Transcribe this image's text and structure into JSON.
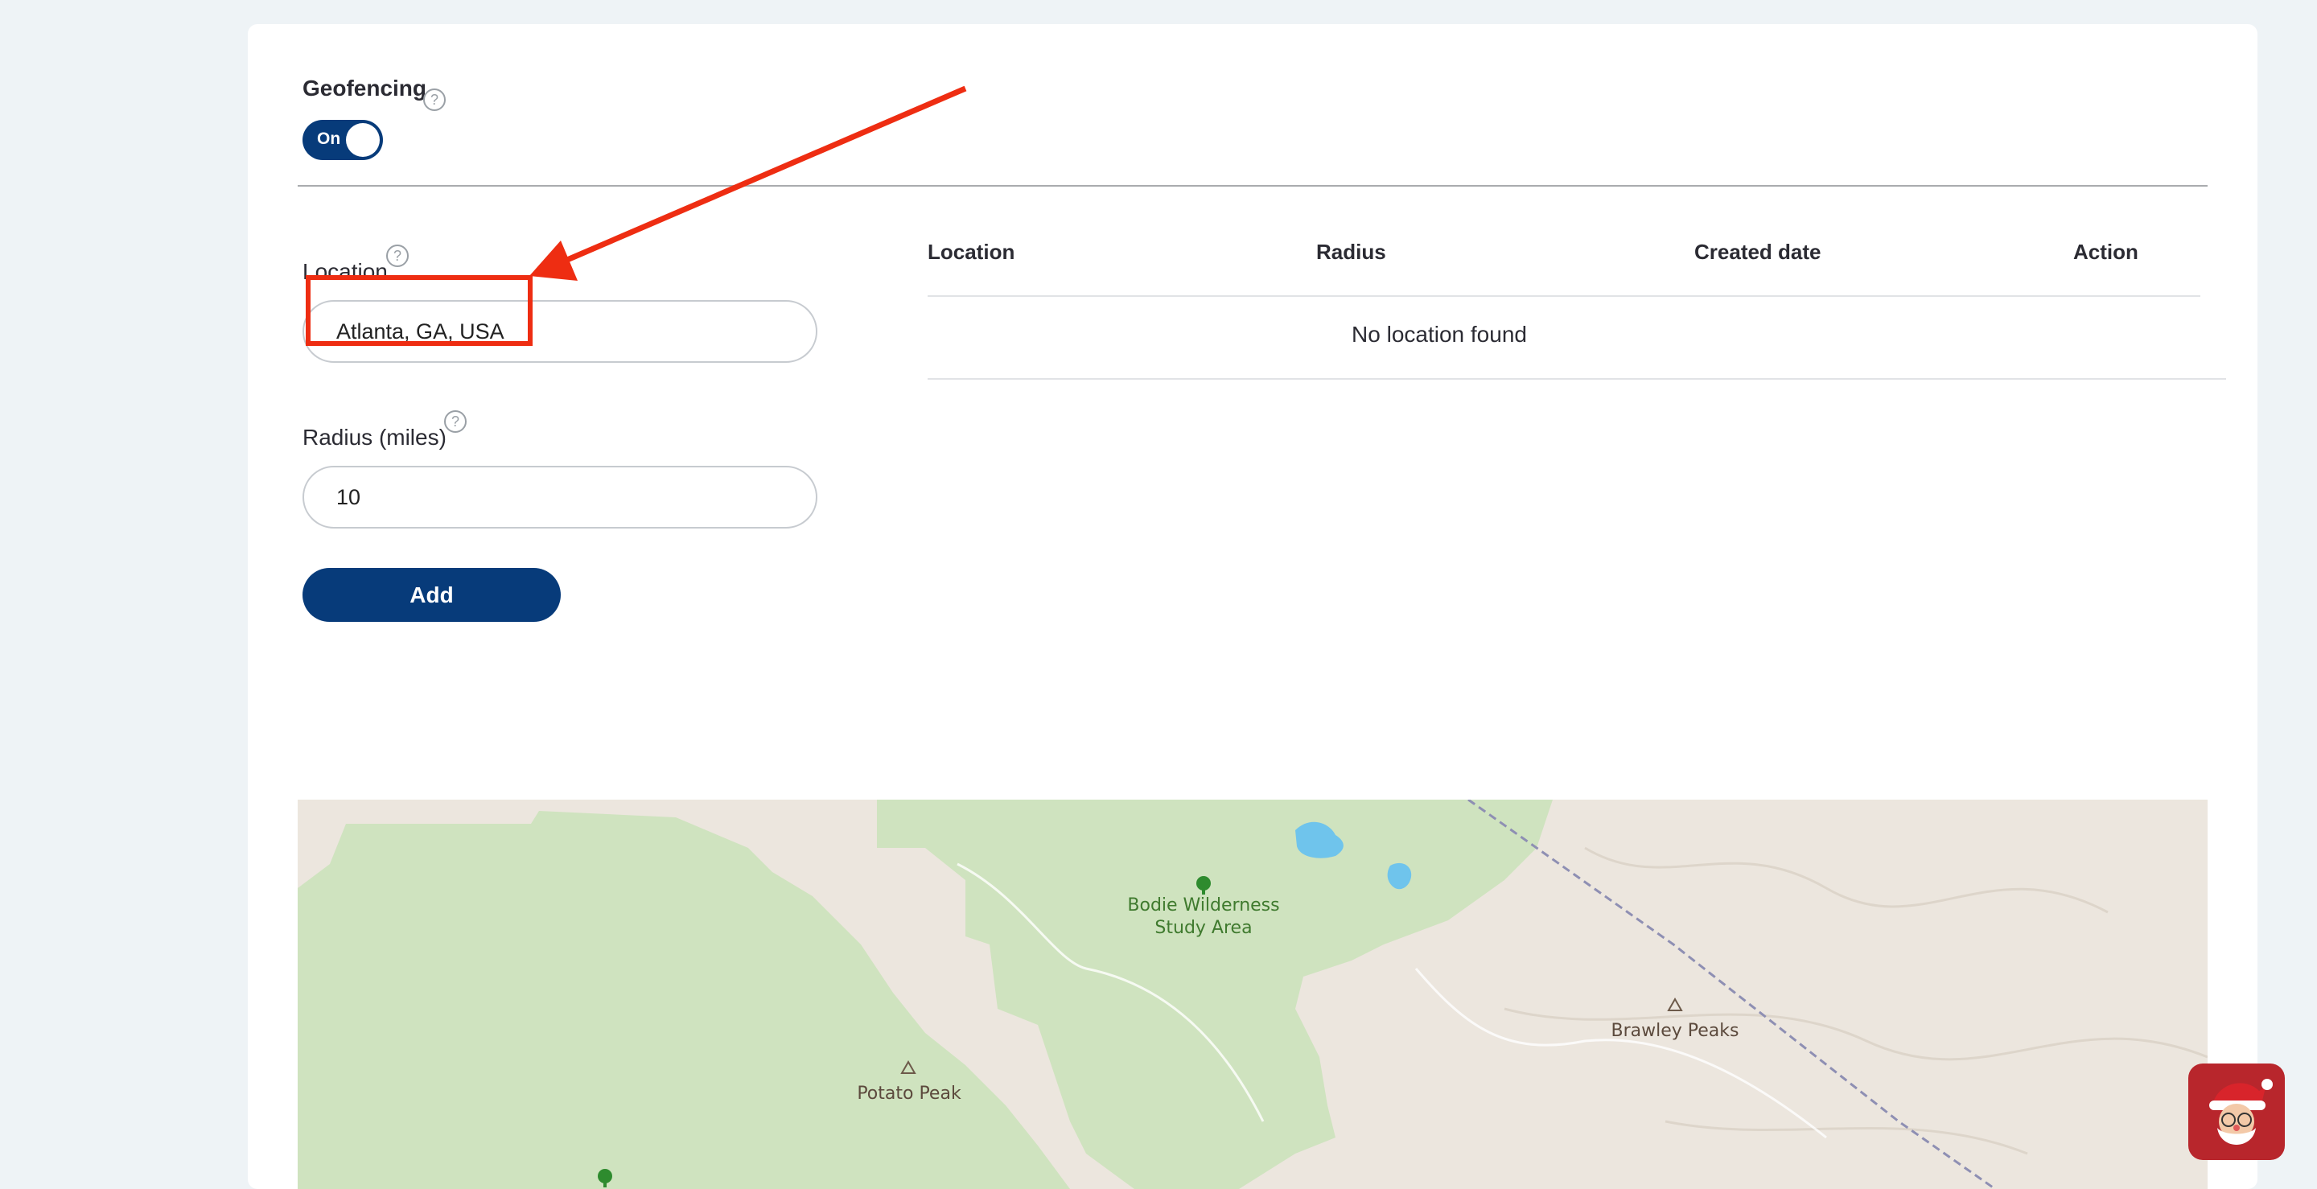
{
  "geofencing": {
    "title": "Geofencing",
    "help": "?",
    "toggle_label": "On"
  },
  "form": {
    "location_label": "Location",
    "location_help": "?",
    "location_value": "Atlanta, GA, USA",
    "radius_label": "Radius (miles)",
    "radius_help": "?",
    "radius_value": "10",
    "add_label": "Add"
  },
  "table": {
    "columns": [
      "Location",
      "Radius",
      "Created date",
      "Action"
    ],
    "empty_message": "No location found"
  },
  "map": {
    "labels": {
      "bodie_line1": "Bodie Wilderness",
      "bodie_line2": "Study Area",
      "potato": "Potato Peak",
      "brawley": "Brawley Peaks"
    }
  },
  "colors": {
    "primary": "#073b7a",
    "annotation": "#ee2d12",
    "map_land": "#ece6de",
    "map_park": "#cfe3bf",
    "map_water": "#6fc4ec"
  },
  "icons": {
    "help": "question-circle-icon",
    "tree": "tree-icon",
    "peak": "mountain-peak-icon",
    "assistant": "santa-avatar-icon"
  }
}
